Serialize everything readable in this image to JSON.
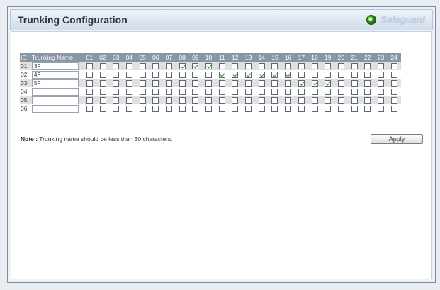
{
  "header": {
    "title": "Trunking Configuration",
    "safeguard_label": "Safeguard"
  },
  "table": {
    "id_header": "ID",
    "name_header": "Trunking Name",
    "ports": [
      "01",
      "02",
      "03",
      "04",
      "05",
      "06",
      "07",
      "08",
      "09",
      "10",
      "11",
      "12",
      "13",
      "14",
      "15",
      "16",
      "17",
      "18",
      "19",
      "20",
      "21",
      "22",
      "23",
      "24"
    ],
    "rows": [
      {
        "id": "01",
        "name": "3F",
        "checked": [
          8,
          9,
          10
        ]
      },
      {
        "id": "02",
        "name": "4F",
        "checked": [
          11,
          12,
          13,
          14,
          15,
          16
        ]
      },
      {
        "id": "03",
        "name": "5F",
        "checked": [
          17,
          18,
          19
        ]
      },
      {
        "id": "04",
        "name": "",
        "checked": []
      },
      {
        "id": "05",
        "name": "",
        "checked": []
      },
      {
        "id": "06",
        "name": "",
        "checked": []
      }
    ]
  },
  "note": {
    "label": "Note :",
    "text": " Trunking name should be less than 30 characters."
  },
  "apply_label": "Apply",
  "colors": {
    "header_bg": "#8b96a5",
    "check_green": "#2e8b1f",
    "safeguard_green": "#38a51f"
  }
}
